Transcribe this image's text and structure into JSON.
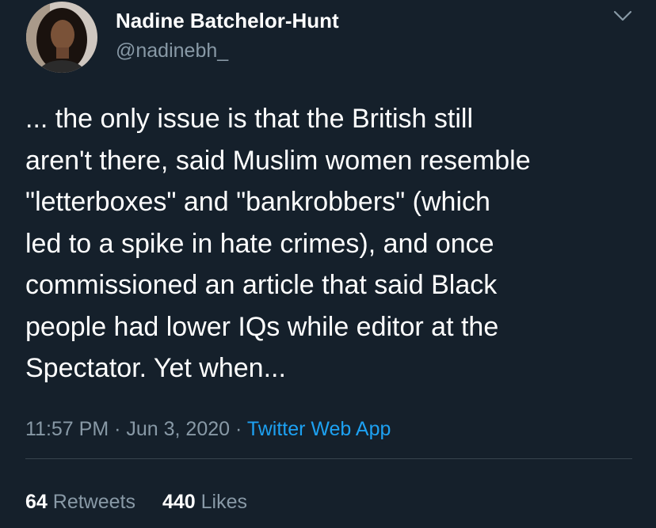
{
  "author": {
    "name": "Nadine Batchelor-Hunt",
    "handle": "@nadinebh_"
  },
  "tweet": {
    "text": "... the only issue is that the British still\naren't there, said Muslim women resemble\n\"letterboxes\" and \"bankrobbers\" (which\nled to a spike in hate crimes), and once\ncommissioned an article that said Black\npeople had lower IQs while editor at the\nSpectator. Yet when...",
    "time": "11:57 PM",
    "separator1": " · ",
    "date": "Jun 3, 2020",
    "separator2": " · ",
    "source": "Twitter Web App"
  },
  "stats": {
    "retweets_count": "64",
    "retweets_label": "Retweets",
    "likes_count": "440",
    "likes_label": "Likes"
  },
  "icons": {
    "menu": "chevron-down-icon"
  },
  "colors": {
    "background": "#15202b",
    "text": "#ffffff",
    "secondary": "#8899a6",
    "link": "#1da1f2",
    "divider": "#38444d"
  }
}
